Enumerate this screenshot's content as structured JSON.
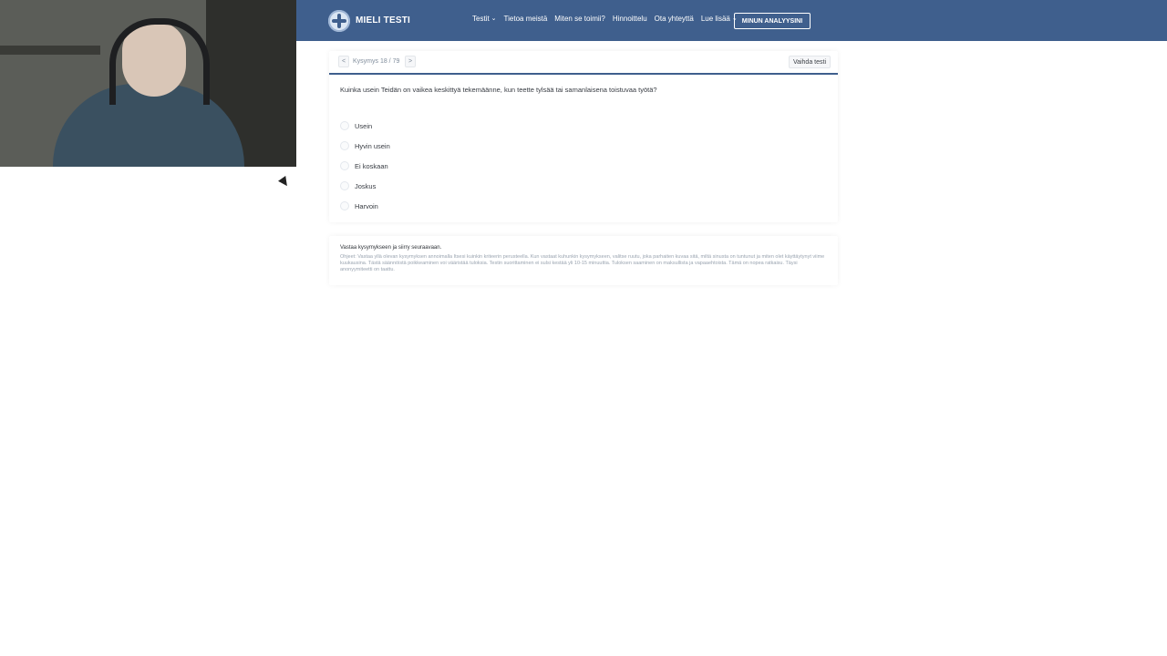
{
  "header": {
    "brand": "MIELI TESTI",
    "nav": [
      {
        "label": "Testit",
        "has_caret": true
      },
      {
        "label": "Tietoa meistä",
        "has_caret": false
      },
      {
        "label": "Miten se toimii?",
        "has_caret": false
      },
      {
        "label": "Hinnoittelu",
        "has_caret": false
      },
      {
        "label": "Ota yhteyttä",
        "has_caret": false
      },
      {
        "label": "Lue lisää",
        "has_caret": true
      }
    ],
    "cta": "MINUN ANALYYSINI",
    "colors": {
      "bar": "#3f5f8d",
      "text": "#ffffff"
    }
  },
  "question": {
    "prev_label": "<",
    "counter": "Kysymys 18 / 79",
    "next_label": ">",
    "switch_label": "Vaihda testi",
    "text": "Kuinka usein Teidän on vaikea keskittyä tekemäänne, kun teette tylsää tai samanlaisena toistuvaa työtä?",
    "answers": [
      "Usein",
      "Hyvin usein",
      "Ei koskaan",
      "Joskus",
      "Harvoin"
    ]
  },
  "instructions": {
    "title": "Vastaa kysymykseen ja siirry seuraavaan.",
    "body": "Ohjeet: Vastaa yllä olevan kysymyksen annoimalla Itsesi kuinkin kriteerin perusteella. Kun vastaat kuhunkin kysymykseen, valitse ruutu, joka parhaiten kuvaa sitä, miltä sinusta on tuntunut ja miten olet käyttäytynyt viime kuukausina. Tästä säännöistä poikkeaminen voi vääristää tuloksia. Testin suorittaminen ei sulsi kestää yli 10-15 minuuttia. Tuloksen saaminen on maksullista ja vapaaehtoista. Tämä on nopea ratkaisu. Täysi anonyymiteetti on taattu."
  }
}
